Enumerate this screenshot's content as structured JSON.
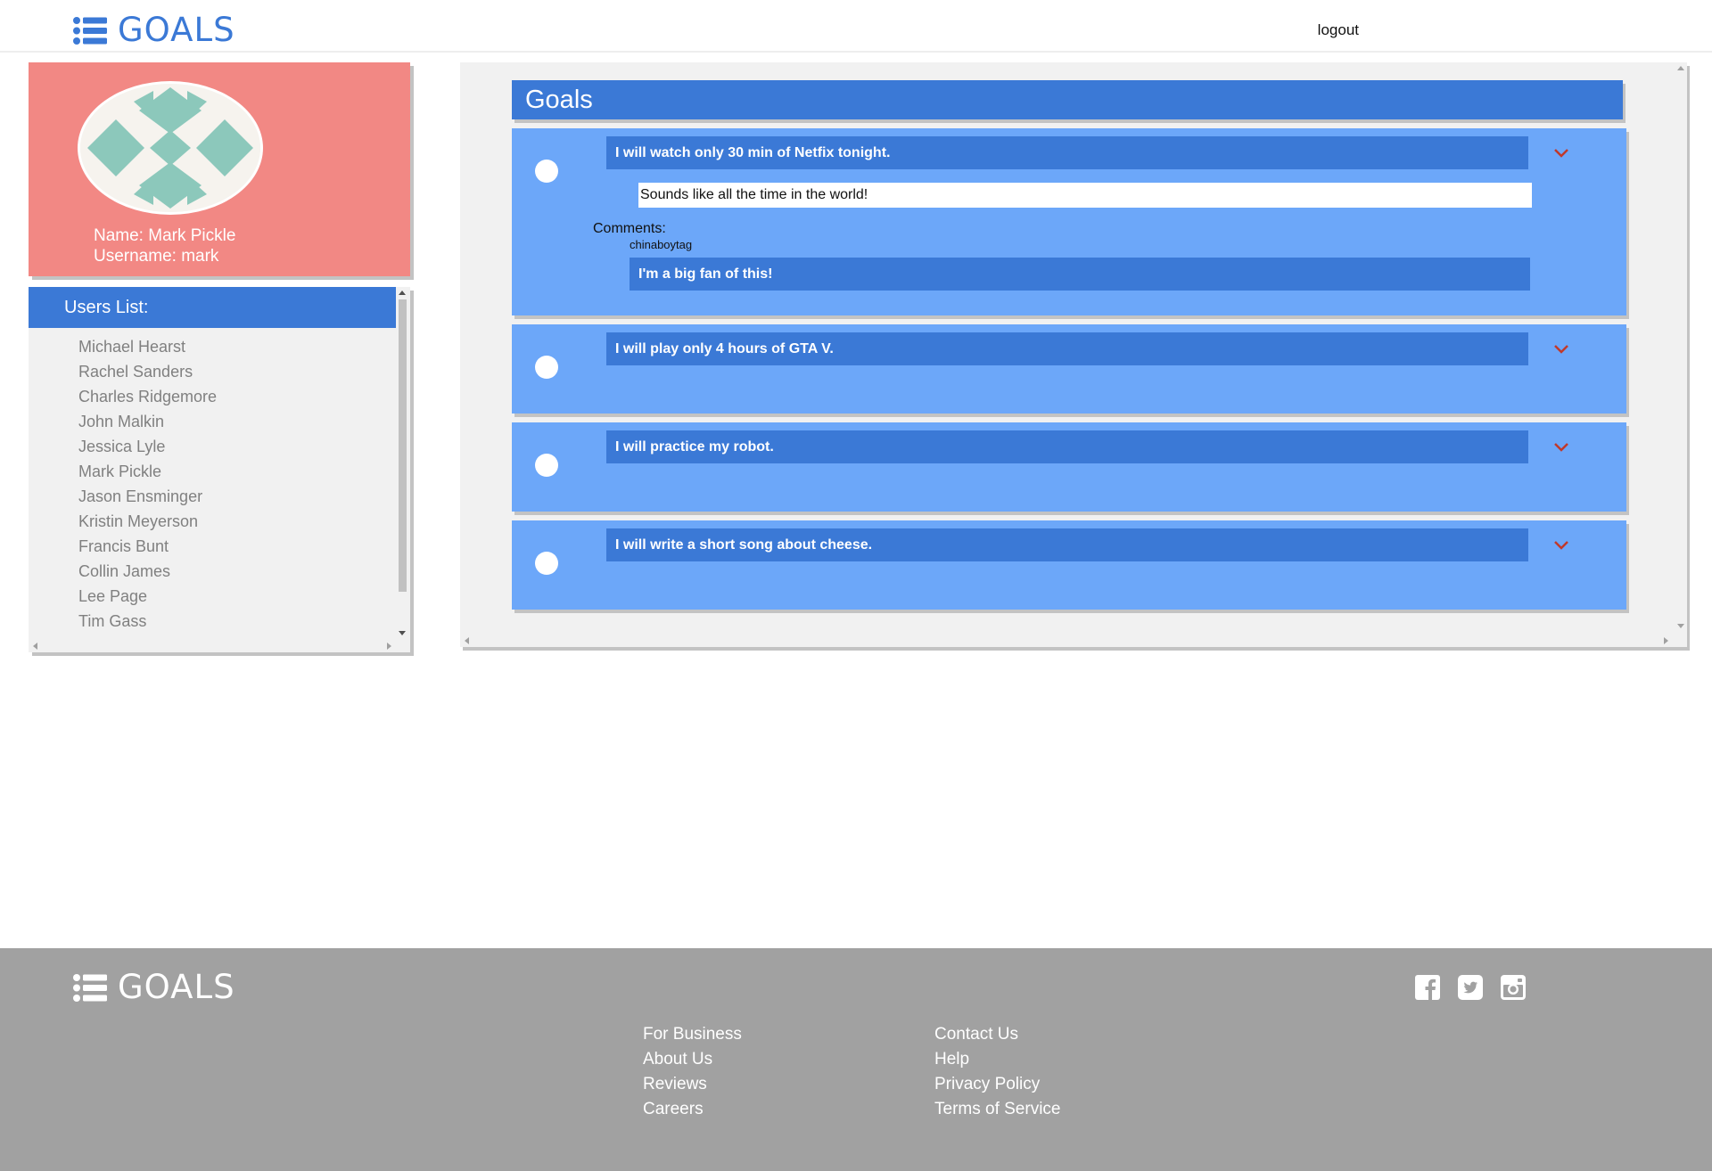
{
  "header": {
    "brand": "GOALS",
    "logout": "logout"
  },
  "profile": {
    "name": "Name: Mark Pickle",
    "username": "Username: mark"
  },
  "users": {
    "title": "Users List:",
    "items": [
      "Michael Hearst",
      "Rachel Sanders",
      "Charles Ridgemore",
      "John Malkin",
      "Jessica Lyle",
      "Mark Pickle",
      "Jason Ensminger",
      "Kristin Meyerson",
      "Francis Bunt",
      "Collin James",
      "Lee Page",
      "Tim Gass"
    ]
  },
  "goals": {
    "title": "Goals",
    "items": [
      {
        "text": "I will watch only 30 min of Netfix tonight.",
        "reply": "Sounds like all the time in the world!",
        "comments_label": "Comments:",
        "commenter": "chinaboytag",
        "comment": "I'm a big fan of this!"
      },
      {
        "text": "I will play only 4 hours of GTA V."
      },
      {
        "text": "I will practice my robot."
      },
      {
        "text": "I will write a short song about cheese."
      }
    ]
  },
  "footer": {
    "brand": "GOALS",
    "col1": [
      "For Business",
      "About Us",
      "Reviews",
      "Careers"
    ],
    "col2": [
      "Contact Us",
      "Help",
      "Privacy Policy",
      "Terms of Service"
    ],
    "social": [
      "facebook-icon",
      "twitter-icon",
      "instagram-icon"
    ]
  },
  "colors": {
    "primary": "#3b79d6",
    "goal_card": "#6ca7f9",
    "profile_bg": "#f28884",
    "footer_bg": "#a1a1a1",
    "chevron": "#c0392b"
  }
}
